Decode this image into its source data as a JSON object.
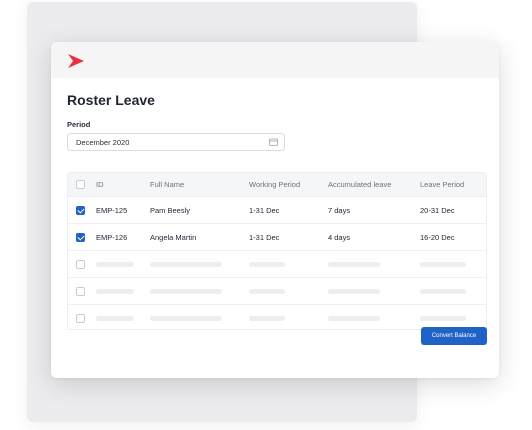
{
  "page": {
    "title": "Roster Leave"
  },
  "period": {
    "label": "Period",
    "value": "December 2020"
  },
  "table": {
    "headers": [
      "ID",
      "Full Name",
      "Working Period",
      "Accumulated leave",
      "Leave Period"
    ],
    "rows": [
      {
        "checked": true,
        "id": "EMP-125",
        "name": "Pam Beesly",
        "working": "1-31 Dec",
        "accumulated": "7 days",
        "leave": "20-31 Dec"
      },
      {
        "checked": true,
        "id": "EMP-126",
        "name": "Angela Martin",
        "working": "1-31 Dec",
        "accumulated": "4 days",
        "leave": "16-20 Dec"
      }
    ],
    "placeholder_rows": 3
  },
  "actions": {
    "convert_label": "Convert Balance"
  },
  "colors": {
    "accent": "#1f63c6",
    "logo": "#e8313d"
  },
  "icons": {
    "logo": "brand-chevron-icon",
    "calendar": "calendar-icon"
  }
}
